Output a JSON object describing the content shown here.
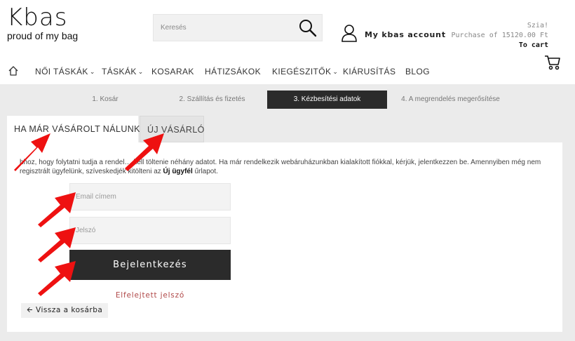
{
  "header": {
    "logo_text": "Kbas",
    "tagline": "proud of my bag",
    "search_placeholder": "Keresés",
    "account_label": "My kbas account",
    "greeting": "Szia!",
    "purchase_info": "Purchase of 15120.00 Ft",
    "to_cart": "To cart"
  },
  "nav": {
    "items": [
      {
        "label": "NŐI TÁSKÁK",
        "dropdown": true
      },
      {
        "label": "TÁSKÁK",
        "dropdown": true
      },
      {
        "label": "KOSARAK",
        "dropdown": false
      },
      {
        "label": "HÁTIZSÁKOK",
        "dropdown": false
      },
      {
        "label": "KIEGÉSZITŐK",
        "dropdown": true
      },
      {
        "label": "KIÁRUSÍTÁS",
        "dropdown": false
      },
      {
        "label": "BLOG",
        "dropdown": false
      }
    ]
  },
  "steps": [
    {
      "label": "1. Kosár",
      "active": false
    },
    {
      "label": "2. Szállítás és fizetés",
      "active": false
    },
    {
      "label": "3. Kézbesítési adatok",
      "active": true
    },
    {
      "label": "4. A megrendelés megerősítése",
      "active": false
    }
  ],
  "tabs": {
    "returning": "HA MÁR VÁSÁROLT NÁLUNK",
    "new": "ÚJ VÁSÁRLÓ"
  },
  "login": {
    "intro_before": "hhoz, hogy folytatni tudja a rendel… kell töltenie néhány adatot. Ha már rendelkezik webáruházunkban kialakított fiókkal, kérjük, jelentkezzen be. Amennyiben még nem regisztrált ügyfelünk, szíveskedjék kitölteni az",
    "intro_link": "Új ügyfél",
    "intro_after": "űrlapot.",
    "email_placeholder": "Email címem",
    "password_placeholder": "Jelszó",
    "login_button": "Bejelentkezés",
    "forgot_password": "Elfelejtett jelszó",
    "back_to_cart": "Vissza a kosárba"
  },
  "colors": {
    "annotation_arrow": "#ee1111",
    "dark_button": "#2b2b2b",
    "forgot_link": "#b04848"
  }
}
